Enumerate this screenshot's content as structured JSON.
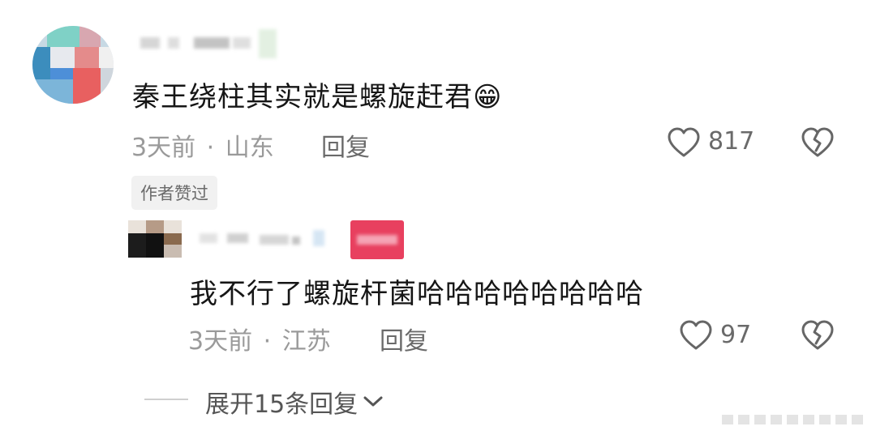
{
  "comment": {
    "text": "秦王绕柱其实就是螺旋赶君",
    "emoji": "😁",
    "time": "3天前",
    "separator": "·",
    "location": "山东",
    "reply_label": "回复",
    "like_count": "817",
    "author_badge": "作者赞过"
  },
  "reply": {
    "text": "我不行了螺旋杆菌哈哈哈哈哈哈哈哈",
    "time": "3天前",
    "separator": "·",
    "location": "江苏",
    "reply_label": "回复",
    "like_count": "97"
  },
  "expand": {
    "label": "展开15条回复"
  },
  "icons": {
    "like": "heart-outline-icon",
    "dislike": "broken-heart-icon",
    "expand": "chevron-down-icon"
  },
  "colors": {
    "text_primary": "#161616",
    "text_secondary": "#9a9a9a",
    "icon_stroke": "#666666",
    "badge_bg": "#f1f1f1"
  }
}
